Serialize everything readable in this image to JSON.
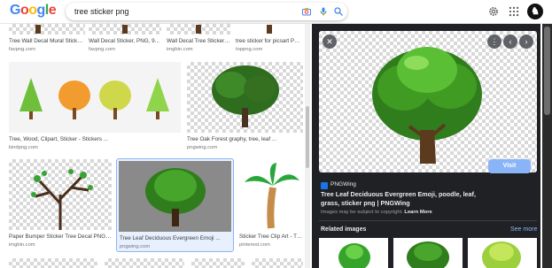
{
  "header": {
    "logo_letters": [
      {
        "ch": "G",
        "color": "#4285f4"
      },
      {
        "ch": "o",
        "color": "#ea4335"
      },
      {
        "ch": "o",
        "color": "#fbbc05"
      },
      {
        "ch": "g",
        "color": "#4285f4"
      },
      {
        "ch": "l",
        "color": "#34a853"
      },
      {
        "ch": "e",
        "color": "#ea4335"
      }
    ],
    "search_value": "tree sticker png",
    "icons": [
      "close-icon",
      "camera-icon",
      "microphone-icon",
      "search-icon",
      "gear-icon",
      "apps-grid-icon"
    ]
  },
  "results": {
    "row1": [
      {
        "caption": "Tree Wall Decal Mural Sticker, ...",
        "source": "favpng.com"
      },
      {
        "caption": "Wall Decal Sticker, PNG, 9...",
        "source": "favpng.com"
      },
      {
        "caption": "Wall Decal Tree Sticker ...",
        "source": "imgbin.com"
      },
      {
        "caption": "tree sticker for picsart PNG ...",
        "source": "toppng.com"
      }
    ],
    "row2": [
      {
        "caption": "Tree, Wood, Clipart, Sticker - Stickers ...",
        "source": "kindpng.com"
      },
      {
        "caption": "Tree Oak Forest graphy, tree, leaf ...",
        "source": "pngwing.com"
      }
    ],
    "row3": [
      {
        "caption": "Paper Bumper Sticker Tree Decal PNG ...",
        "source": "imgbin.com"
      },
      {
        "caption": "Tree Leaf Deciduous Evergreen Emoji ...",
        "source": "pngwing.com"
      },
      {
        "caption": "Sticker Tree Clip Art - Tra...",
        "source": "pinterest.com"
      }
    ]
  },
  "panel": {
    "site": "PNGWing",
    "title": "Tree Leaf Deciduous Evergreen Emoji, poodle, leaf, grass, sticker png | PNGWing",
    "visit_label": "Visit",
    "copyright_text": "Images may be subject to copyright.",
    "learn_more": "Learn More",
    "related_label": "Related images",
    "see_more_label": "See more",
    "icons": [
      "close-icon",
      "more-vert-icon",
      "chevron-left-icon",
      "chevron-right-icon"
    ]
  },
  "colors": {
    "panel_bg": "#202124",
    "accent": "#8ab4f8",
    "tree_green": "#3f9b22",
    "trunk_brown": "#5b3a1e"
  }
}
